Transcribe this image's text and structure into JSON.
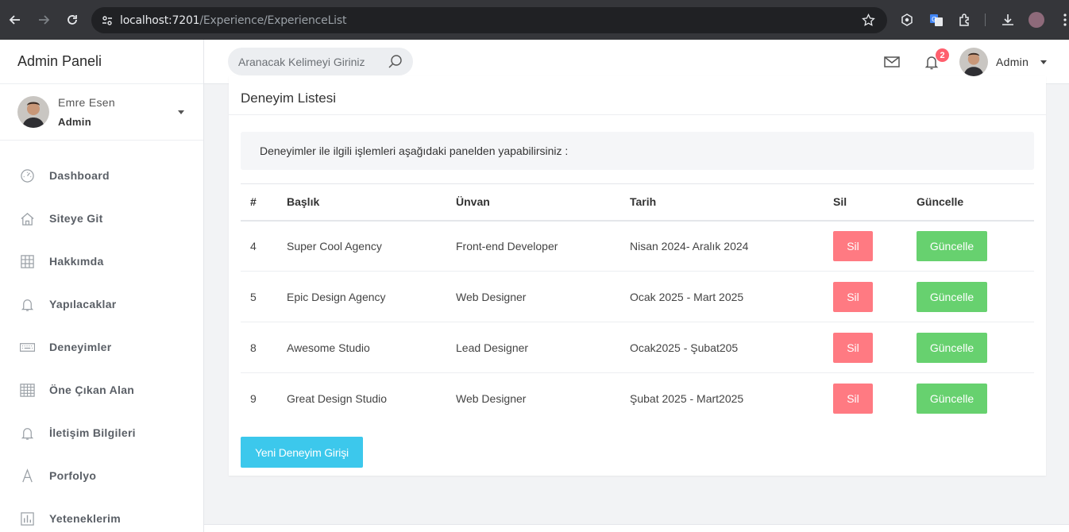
{
  "browser": {
    "url_host": "localhost:7201",
    "url_path": "/Experience/ExperienceList"
  },
  "sidebar": {
    "brand": "Admin Paneli",
    "profile": {
      "name": "Emre Esen",
      "role": "Admin"
    },
    "items": [
      {
        "label": "Dashboard",
        "icon": "gauge-icon"
      },
      {
        "label": "Siteye Git",
        "icon": "home-icon"
      },
      {
        "label": "Hakkımda",
        "icon": "grid-icon"
      },
      {
        "label": "Yapılacaklar",
        "icon": "bell-icon"
      },
      {
        "label": "Deneyimler",
        "icon": "keyboard-icon"
      },
      {
        "label": "Öne Çıkan Alan",
        "icon": "table-icon"
      },
      {
        "label": "İletişim Bilgileri",
        "icon": "bell-icon"
      },
      {
        "label": "Porfolyo",
        "icon": "letter-a-icon"
      },
      {
        "label": "Yeteneklerim",
        "icon": "chart-icon"
      }
    ]
  },
  "header": {
    "search_placeholder": "Aranacak Kelimeyi Giriniz",
    "notification_count": "2",
    "user_name": "Admin"
  },
  "main": {
    "title": "Deneyim Listesi",
    "info": "Deneyimler ile ilgili işlemleri aşağıdaki panelden yapabilirsiniz :",
    "columns": [
      "#",
      "Başlık",
      "Ünvan",
      "Tarih",
      "Sil",
      "Güncelle"
    ],
    "rows": [
      {
        "id": "4",
        "title": "Super Cool Agency",
        "position": "Front-end Developer",
        "date": "Nisan 2024- Aralık 2024",
        "delete": "Sil",
        "update": "Güncelle"
      },
      {
        "id": "5",
        "title": "Epic Design Agency",
        "position": "Web Designer",
        "date": "Ocak 2025 - Mart 2025",
        "delete": "Sil",
        "update": "Güncelle"
      },
      {
        "id": "8",
        "title": "Awesome Studio",
        "position": "Lead Designer",
        "date": "Ocak2025 - Şubat205",
        "delete": "Sil",
        "update": "Güncelle"
      },
      {
        "id": "9",
        "title": "Great Design Studio",
        "position": "Web Designer",
        "date": "Şubat 2025 - Mart2025",
        "delete": "Sil",
        "update": "Güncelle"
      }
    ],
    "new_button": "Yeni Deneyim Girişi"
  },
  "colors": {
    "delete": "#ff7a82",
    "update": "#67d16f",
    "new": "#3cc8ec",
    "badge": "#ff5f6d"
  }
}
